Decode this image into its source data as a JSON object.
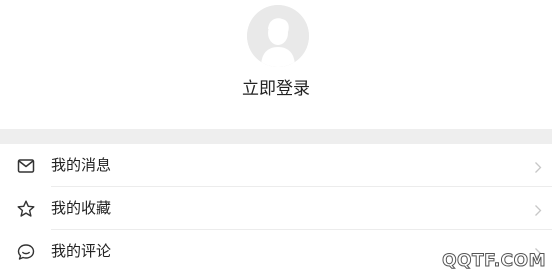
{
  "profile": {
    "login_label": "立即登录"
  },
  "menu": {
    "items": [
      {
        "label": "我的消息",
        "icon": "mail-icon"
      },
      {
        "label": "我的收藏",
        "icon": "star-icon"
      },
      {
        "label": "我的评论",
        "icon": "comment-icon"
      }
    ]
  },
  "watermark": {
    "text": "QQTF.COM"
  },
  "colors": {
    "separator": "#eeeeee",
    "text": "#222222",
    "avatar_bg": "#e9e9e9",
    "chevron": "#c7c7c7"
  }
}
